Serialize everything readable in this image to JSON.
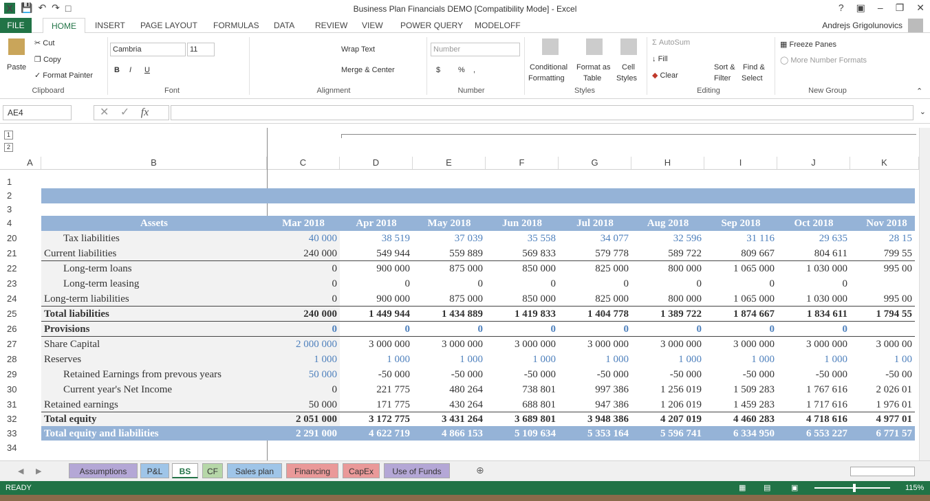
{
  "titlebar": {
    "title": "Business Plan Financials DEMO  [Compatibility Mode] - Excel",
    "help": "?",
    "user": "Andrejs Grigolunovics"
  },
  "ribbon_tabs": [
    "FILE",
    "HOME",
    "INSERT",
    "PAGE LAYOUT",
    "FORMULAS",
    "DATA",
    "REVIEW",
    "VIEW",
    "POWER QUERY",
    "MODELOFF"
  ],
  "ribbon": {
    "clipboard": {
      "paste": "Paste",
      "cut": "Cut",
      "copy": "Copy",
      "format_painter": "Format Painter",
      "label": "Clipboard"
    },
    "font": {
      "name": "Cambria",
      "size": "11",
      "label": "Font",
      "bold": "B",
      "italic": "I",
      "underline": "U"
    },
    "alignment": {
      "wrap": "Wrap Text",
      "merge": "Merge & Center",
      "label": "Alignment"
    },
    "number": {
      "format": "Number",
      "currency": "$",
      "percent": "%",
      "comma": ",",
      "label": "Number"
    },
    "styles": {
      "conditional": "Conditional",
      "conditional2": "Formatting",
      "format_as": "Format as",
      "format_as2": "Table",
      "cell": "Cell",
      "cell2": "Styles",
      "label": "Styles"
    },
    "editing": {
      "autosum": "AutoSum",
      "fill": "Fill",
      "clear": "Clear",
      "sort": "Sort &",
      "sort2": "Filter",
      "find": "Find &",
      "find2": "Select",
      "label": "Editing"
    },
    "newgroup": {
      "freeze": "Freeze Panes",
      "more": "More Number Formats",
      "label": "New Group"
    }
  },
  "formula_bar": {
    "namebox": "AE4",
    "fx": "fx",
    "value": ""
  },
  "outline": [
    "1",
    "2"
  ],
  "columns": [
    "A",
    "B",
    "C",
    "D",
    "E",
    "F",
    "G",
    "H",
    "I",
    "J",
    "K"
  ],
  "rows": {
    "numbers": [
      "1",
      "2",
      "3",
      "4",
      "20",
      "21",
      "22",
      "23",
      "24",
      "25",
      "26",
      "27",
      "28",
      "29",
      "30",
      "31",
      "32",
      "33",
      "34"
    ]
  },
  "header_row": {
    "label": "Assets",
    "months": [
      "Mar 2018",
      "Apr 2018",
      "May 2018",
      "Jun 2018",
      "Jul 2018",
      "Aug 2018",
      "Sep 2018",
      "Oct 2018",
      "Nov 2018"
    ]
  },
  "table": [
    {
      "label": "Tax liabilities",
      "indent": true,
      "style": "blue",
      "values": [
        "40 000",
        "38 519",
        "37 039",
        "35 558",
        "34 077",
        "32 596",
        "31 116",
        "29 635",
        "28 15"
      ]
    },
    {
      "label": "Current liabilities",
      "indent": false,
      "style": "normal",
      "values": [
        "240 000",
        "549 944",
        "559 889",
        "569 833",
        "579 778",
        "589 722",
        "809 667",
        "804 611",
        "799 55"
      ]
    },
    {
      "label": "Long-term loans",
      "indent": true,
      "style": "normal",
      "values": [
        "0",
        "900 000",
        "875 000",
        "850 000",
        "825 000",
        "800 000",
        "1 065 000",
        "1 030 000",
        "995 00"
      ]
    },
    {
      "label": "Long-term leasing",
      "indent": true,
      "style": "normal",
      "values": [
        "0",
        "0",
        "0",
        "0",
        "0",
        "0",
        "0",
        "0",
        ""
      ]
    },
    {
      "label": "Long-term liabilities",
      "indent": false,
      "style": "normal",
      "values": [
        "0",
        "900 000",
        "875 000",
        "850 000",
        "825 000",
        "800 000",
        "1 065 000",
        "1 030 000",
        "995 00"
      ]
    },
    {
      "label": "Total liabilities",
      "indent": false,
      "style": "bold",
      "values": [
        "240 000",
        "1 449 944",
        "1 434 889",
        "1 419 833",
        "1 404 778",
        "1 389 722",
        "1 874 667",
        "1 834 611",
        "1 794 55"
      ]
    },
    {
      "label": "Provisions",
      "indent": false,
      "style": "bold-blue",
      "values": [
        "0",
        "0",
        "0",
        "0",
        "0",
        "0",
        "0",
        "0",
        ""
      ]
    },
    {
      "label": "Share Capital",
      "indent": false,
      "style": "mixed",
      "values": [
        "2 000 000",
        "3 000 000",
        "3 000 000",
        "3 000 000",
        "3 000 000",
        "3 000 000",
        "3 000 000",
        "3 000 000",
        "3 000 00"
      ]
    },
    {
      "label": "Reserves",
      "indent": false,
      "style": "blue-vals",
      "values": [
        "1 000",
        "1 000",
        "1 000",
        "1 000",
        "1 000",
        "1 000",
        "1 000",
        "1 000",
        "1 00"
      ]
    },
    {
      "label": "Retained Earnings from prevous years",
      "indent": true,
      "style": "mixed",
      "values": [
        "50 000",
        "-50 000",
        "-50 000",
        "-50 000",
        "-50 000",
        "-50 000",
        "-50 000",
        "-50 000",
        "-50 00"
      ]
    },
    {
      "label": "Current year's Net Income",
      "indent": true,
      "style": "normal",
      "values": [
        "0",
        "221 775",
        "480 264",
        "738 801",
        "997 386",
        "1 256 019",
        "1 509 283",
        "1 767 616",
        "2 026 01"
      ]
    },
    {
      "label": "Retained earnings",
      "indent": false,
      "style": "normal",
      "values": [
        "50 000",
        "171 775",
        "430 264",
        "688 801",
        "947 386",
        "1 206 019",
        "1 459 283",
        "1 717 616",
        "1 976 01"
      ]
    },
    {
      "label": "Total equity",
      "indent": false,
      "style": "bold",
      "values": [
        "2 051 000",
        "3 172 775",
        "3 431 264",
        "3 689 801",
        "3 948 386",
        "4 207 019",
        "4 460 283",
        "4 718 616",
        "4 977 01"
      ]
    },
    {
      "label": "Total equity and liabilities",
      "indent": false,
      "style": "band",
      "values": [
        "2 291 000",
        "4 622 719",
        "4 866 153",
        "5 109 634",
        "5 353 164",
        "5 596 741",
        "6 334 950",
        "6 553 227",
        "6 771 57"
      ]
    }
  ],
  "sheet_tabs": [
    {
      "name": "Assumptions",
      "color": "#b4a7d6"
    },
    {
      "name": "P&L",
      "color": "#9fc5e8"
    },
    {
      "name": "BS",
      "color": "#ffffff"
    },
    {
      "name": "CF",
      "color": "#b6d7a8"
    },
    {
      "name": "Sales plan",
      "color": "#9fc5e8"
    },
    {
      "name": "Financing",
      "color": "#ea9999"
    },
    {
      "name": "CapEx",
      "color": "#ea9999"
    },
    {
      "name": "Use of Funds",
      "color": "#b4a7d6"
    }
  ],
  "status": {
    "mode": "READY",
    "zoom": "115%"
  },
  "colors": {
    "accent": "#217346",
    "header_band": "#95b3d7",
    "blue_text": "#4f81bd"
  }
}
